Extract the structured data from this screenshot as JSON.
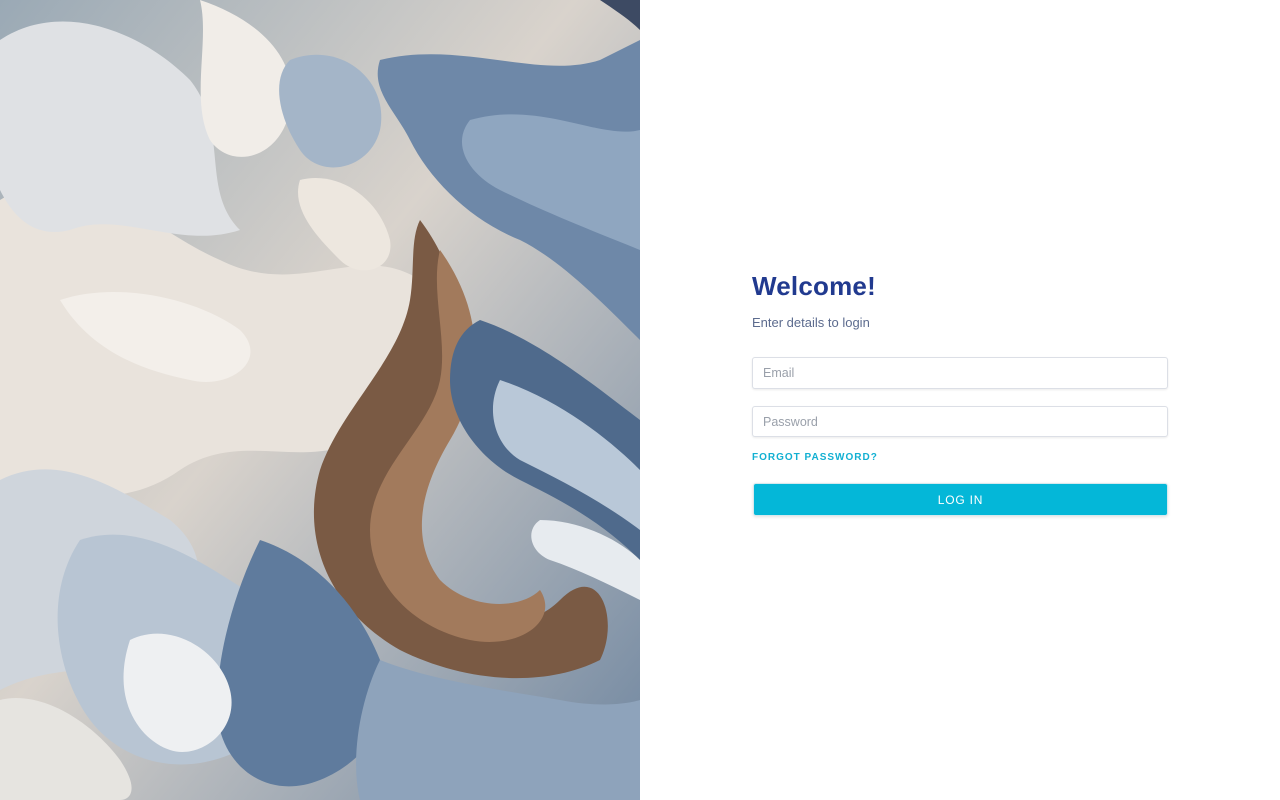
{
  "welcome": {
    "title": "Welcome!",
    "subtitle": "Enter details to login"
  },
  "form": {
    "email_placeholder": "Email",
    "password_placeholder": "Password",
    "forgot_label": "FORGOT PASSWORD?",
    "login_label": "LOG IN"
  },
  "colors": {
    "title": "#213a8f",
    "accent": "#04b7d8",
    "link": "#12b0d2"
  },
  "background_art": {
    "icon": "abstract-swirl-painting"
  }
}
